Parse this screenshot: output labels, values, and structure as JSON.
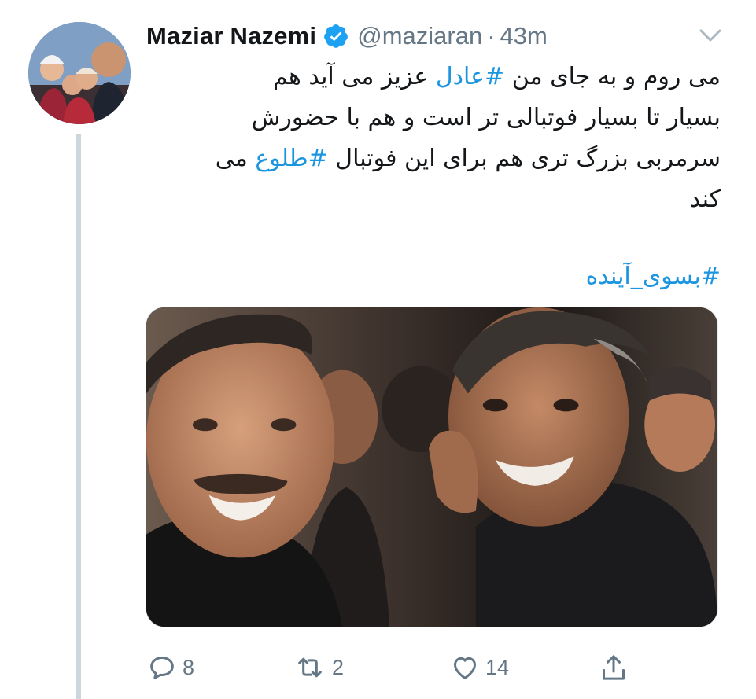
{
  "tweet": {
    "author": {
      "display_name": "Maziar Nazemi",
      "handle": "@maziaran",
      "verified": true
    },
    "separator": "·",
    "time": "43m",
    "text_lines": [
      {
        "before": "می روم و به جای من ",
        "tag": "#عادل",
        "after": " عزیز می آید هم"
      },
      {
        "text": "بسیار تا بسیار فوتبالی تر است و هم با حضورش"
      },
      {
        "before": "سرمربی بزرگ تری هم برای این فوتبال ",
        "tag": "#طلوع",
        "after": " می"
      },
      {
        "text": "کند"
      }
    ],
    "hashtag_line": "#بسوی_آینده",
    "actions": {
      "reply": {
        "icon": "reply-icon",
        "count": "8"
      },
      "retweet": {
        "icon": "retweet-icon",
        "count": "2"
      },
      "like": {
        "icon": "heart-icon",
        "count": "14"
      },
      "share": {
        "icon": "share-icon"
      }
    }
  },
  "colors": {
    "link": "#1b95e0",
    "muted": "#657786",
    "thread_line": "#ccd6dd",
    "verified": "#1da1f2"
  }
}
